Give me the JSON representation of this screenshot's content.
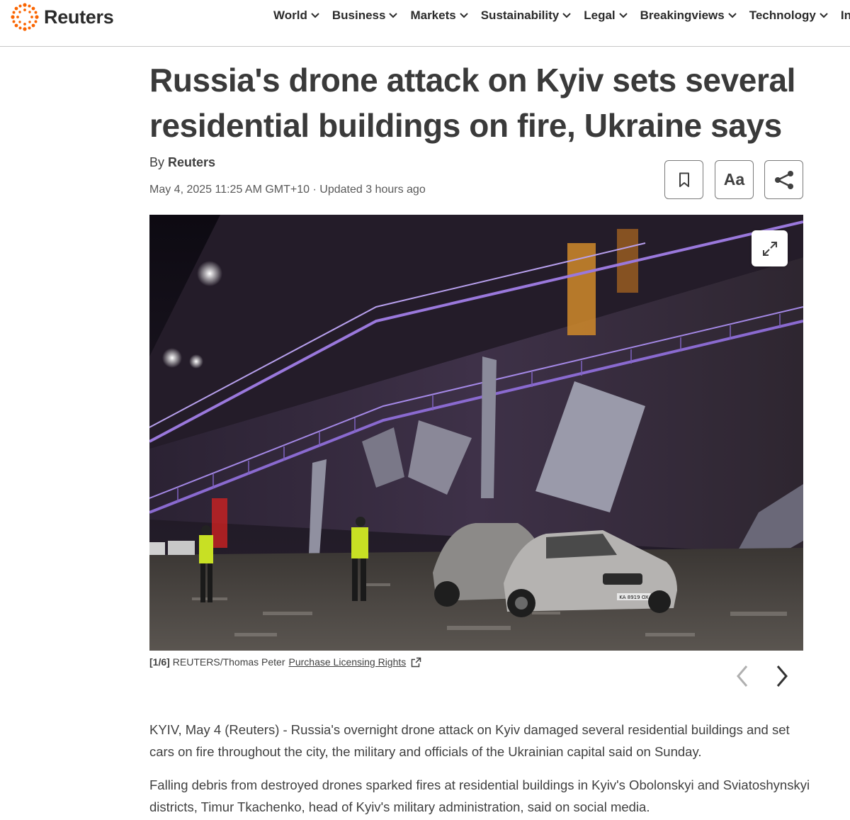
{
  "brand": {
    "name": "Reuters",
    "accent": "#fa6400"
  },
  "nav": {
    "items": [
      {
        "label": "World"
      },
      {
        "label": "Business"
      },
      {
        "label": "Markets"
      },
      {
        "label": "Sustainability"
      },
      {
        "label": "Legal"
      },
      {
        "label": "Breakingviews"
      },
      {
        "label": "Technology"
      },
      {
        "label": "In"
      }
    ],
    "chevron_icon": "chevron-down-icon"
  },
  "article": {
    "headline": "Russia's drone attack on Kyiv sets several residential buildings on fire, Ukraine says",
    "byline_prefix": "By",
    "byline_author": "Reuters",
    "dateline": "May 4, 2025 11:25 AM GMT+10 · Updated 3 hours ago",
    "tools": {
      "save_icon": "bookmark-icon",
      "text_size_label": "Aa",
      "share_icon": "share-icon"
    },
    "photo": {
      "expand_icon": "expand-icon",
      "index": "[1/6]",
      "credit": "REUTERS/Thomas Peter",
      "licensing_link": "Purchase Licensing Rights",
      "licensing_icon": "external-link-icon",
      "prev_icon": "chevron-left-icon",
      "next_icon": "chevron-right-icon",
      "plate": "KA 8919 OX"
    },
    "paragraphs": [
      "KYIV, May 4 (Reuters) - Russia's overnight drone attack on Kyiv damaged several residential buildings and set cars on fire throughout the city, the military and officials of the Ukrainian capital said on Sunday.",
      "Falling debris from destroyed drones sparked fires at residential buildings in Kyiv's Obolonskyi and Sviatoshynskyi districts, Timur Tkachenko, head of Kyiv's military administration, said on social media."
    ]
  }
}
